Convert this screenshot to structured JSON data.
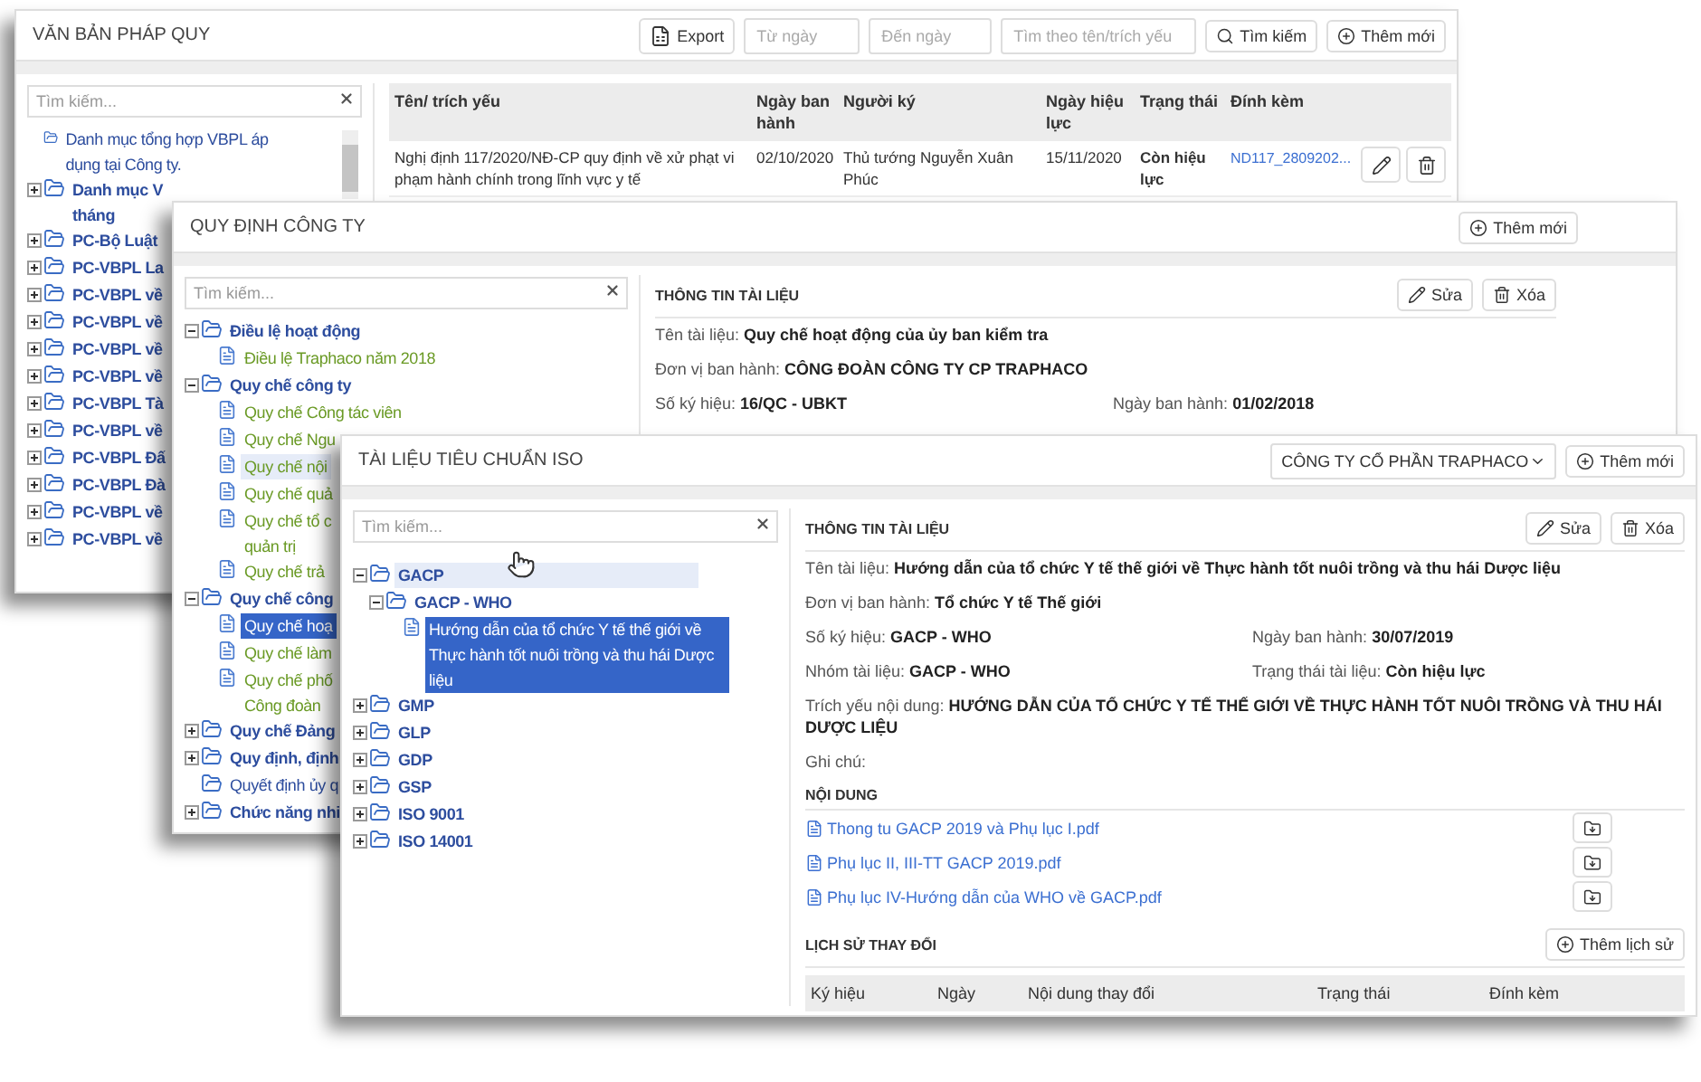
{
  "legal_docs_window": {
    "title": "VĂN BẢN PHÁP QUY",
    "export_button": "Export",
    "from_date": {
      "placeholder": "Từ ngày"
    },
    "to_date": {
      "placeholder": "Đến ngày"
    },
    "search_field": {
      "placeholder": "Tìm theo tên/trích yếu"
    },
    "search_button": "Tìm kiếm",
    "add_button": "Thêm mới",
    "tree_search": {
      "placeholder": "Tìm kiếm..."
    },
    "tree": [
      {
        "kind": "empty-folder",
        "label": "Danh mục tổng hợp VBPL áp dụng tại Công ty.",
        "selected": false,
        "hovered": false
      },
      {
        "kind": "folder",
        "label": "Danh mục V\ntháng",
        "expanded": false,
        "selected": false,
        "hovered": false
      },
      {
        "kind": "folder",
        "label": "PC-Bộ Luật",
        "expanded": false,
        "selected": false,
        "hovered": false
      },
      {
        "kind": "folder",
        "label": "PC-VBPL La",
        "expanded": false,
        "selected": false,
        "hovered": false
      },
      {
        "kind": "folder",
        "label": "PC-VBPL về",
        "expanded": false,
        "selected": false,
        "hovered": false
      },
      {
        "kind": "folder",
        "label": "PC-VBPL về",
        "expanded": false,
        "selected": false,
        "hovered": false
      },
      {
        "kind": "folder",
        "label": "PC-VBPL về",
        "expanded": false,
        "selected": false,
        "hovered": false
      },
      {
        "kind": "folder",
        "label": "PC-VBPL về",
        "expanded": false,
        "selected": false,
        "hovered": false
      },
      {
        "kind": "folder",
        "label": "PC-VBPL Tà",
        "expanded": false,
        "selected": false,
        "hovered": false
      },
      {
        "kind": "folder",
        "label": "PC-VBPL về",
        "expanded": false,
        "selected": false,
        "hovered": false
      },
      {
        "kind": "folder",
        "label": "PC-VBPL Đấ",
        "expanded": false,
        "selected": false,
        "hovered": false
      },
      {
        "kind": "folder",
        "label": "PC-VBPL Đà",
        "expanded": false,
        "selected": false,
        "hovered": false
      },
      {
        "kind": "folder",
        "label": "PC-VBPL về",
        "expanded": false,
        "selected": false,
        "hovered": false
      },
      {
        "kind": "folder",
        "label": "PC-VBPL về",
        "expanded": false,
        "selected": false,
        "hovered": false
      }
    ],
    "table": {
      "columns": [
        "Tên/ trích yếu",
        "Ngày ban hành",
        "Người ký",
        "Ngày hiệu lực",
        "Trạng thái",
        "Đính kèm"
      ],
      "rows": [
        {
          "title": "Nghị định 117/2020/NĐ-CP quy định về xử phạt vi phạm hành chính trong lĩnh vực y tế",
          "issued": "02/10/2020",
          "signer": "Thủ tướng Nguyễn Xuân Phúc",
          "effective": "15/11/2020",
          "status": "Còn hiệu lực",
          "attachment": "ND117_2809202..."
        }
      ]
    }
  },
  "company_rules_window": {
    "title": "QUY ĐỊNH CÔNG TY",
    "add_button": "Thêm mới",
    "tree_search": {
      "placeholder": "Tìm kiếm..."
    },
    "tree": [
      {
        "kind": "folder",
        "label": "Điều lệ hoạt động",
        "expanded": true,
        "selected": false,
        "hovered": false,
        "children": [
          {
            "kind": "document",
            "label": "Điều lệ Traphaco năm 2018",
            "selected": false,
            "hovered": false
          }
        ]
      },
      {
        "kind": "folder",
        "label": "Quy chế công ty",
        "expanded": true,
        "selected": false,
        "hovered": false,
        "children": [
          {
            "kind": "document",
            "label": "Quy chế Công tác viên",
            "selected": false,
            "hovered": false
          },
          {
            "kind": "document",
            "label": "Quy chế Ngu",
            "selected": false,
            "hovered": false
          },
          {
            "kind": "document",
            "label": "Quy chế nội",
            "selected": false,
            "hovered": true
          },
          {
            "kind": "document",
            "label": "Quy chế quả",
            "selected": false,
            "hovered": false
          },
          {
            "kind": "document",
            "label": "Quy chế tổ c\nquản trị",
            "selected": false,
            "hovered": false
          },
          {
            "kind": "document",
            "label": "Quy chế trả",
            "selected": false,
            "hovered": false
          }
        ]
      },
      {
        "kind": "folder",
        "label": "Quy chế công",
        "expanded": true,
        "selected": false,
        "hovered": false,
        "children": [
          {
            "kind": "document",
            "label": "Quy chế hoạ",
            "selected": true,
            "hovered": false
          },
          {
            "kind": "document",
            "label": "Quy chế làm",
            "selected": false,
            "hovered": false
          },
          {
            "kind": "document",
            "label": "Quy chế phố\nCông đoàn",
            "selected": false,
            "hovered": false
          }
        ]
      },
      {
        "kind": "folder",
        "label": "Quy chế Đảng",
        "expanded": false,
        "selected": false,
        "hovered": false
      },
      {
        "kind": "folder",
        "label": "Quy định, định",
        "expanded": false,
        "selected": false,
        "hovered": false
      },
      {
        "kind": "empty-folder",
        "label": "Quyết định ủy q",
        "selected": false,
        "hovered": false
      },
      {
        "kind": "folder",
        "label": "Chức năng nhi",
        "expanded": false,
        "selected": false,
        "hovered": false
      }
    ],
    "info": {
      "heading": "THÔNG TIN TÀI LIỆU",
      "edit_button": "Sửa",
      "delete_button": "Xóa",
      "fields": [
        {
          "kind": "full",
          "label": "Tên tài liệu:",
          "value": "Quy chế hoạt động của ủy ban kiểm tra"
        },
        {
          "kind": "full",
          "label": "Đơn vị ban hành:",
          "value": "CÔNG ĐOÀN CÔNG TY CP TRAPHACO"
        },
        {
          "kind": "half",
          "label": "Số ký hiệu:",
          "value": "16/QC - UBKT"
        },
        {
          "kind": "half",
          "label": "Ngày ban hành:",
          "value": "01/02/2018"
        }
      ]
    }
  },
  "iso_window": {
    "title": "TÀI LIỆU TIÊU CHUẨN ISO",
    "company_select": {
      "value": "CÔNG TY CỔ PHẦN TRAPHACO"
    },
    "add_button": "Thêm mới",
    "tree_search": {
      "placeholder": "Tìm kiếm..."
    },
    "tree": [
      {
        "kind": "folder",
        "label": "GACP",
        "expanded": true,
        "selected": false,
        "hovered": true,
        "children": [
          {
            "kind": "folder",
            "label": "GACP - WHO",
            "expanded": true,
            "selected": false,
            "hovered": false,
            "children": [
              {
                "kind": "document",
                "label": "Hướng dẫn của tổ chức Y tế thế giới về Thực hành tốt nuôi trồng và thu hái Dược liệu",
                "selected": true,
                "hovered": false
              }
            ]
          }
        ]
      },
      {
        "kind": "folder",
        "label": "GMP",
        "expanded": false,
        "selected": false,
        "hovered": false
      },
      {
        "kind": "folder",
        "label": "GLP",
        "expanded": false,
        "selected": false,
        "hovered": false
      },
      {
        "kind": "folder",
        "label": "GDP",
        "expanded": false,
        "selected": false,
        "hovered": false
      },
      {
        "kind": "folder",
        "label": "GSP",
        "expanded": false,
        "selected": false,
        "hovered": false
      },
      {
        "kind": "folder",
        "label": "ISO 9001",
        "expanded": false,
        "selected": false,
        "hovered": false
      },
      {
        "kind": "folder",
        "label": "ISO 14001",
        "expanded": false,
        "selected": false,
        "hovered": false
      }
    ],
    "info": {
      "heading": "THÔNG TIN TÀI LIỆU",
      "edit_button": "Sửa",
      "delete_button": "Xóa",
      "fields": [
        {
          "kind": "full",
          "label": "Tên tài liệu:",
          "value": "Hướng dẫn của tổ chức Y tế thế giới về Thực hành tốt nuôi trồng và thu hái Dược liệu"
        },
        {
          "kind": "full",
          "label": "Đơn vị ban hành:",
          "value": "Tổ chức Y tế Thế giới"
        },
        {
          "kind": "half",
          "label": "Số ký hiệu:",
          "value": "GACP - WHO"
        },
        {
          "kind": "half",
          "label": "Ngày ban hành:",
          "value": "30/07/2019"
        },
        {
          "kind": "half",
          "label": "Nhóm tài liệu:",
          "value": "GACP - WHO"
        },
        {
          "kind": "half",
          "label": "Trạng thái tài liệu:",
          "value": "Còn hiệu lực"
        },
        {
          "kind": "full",
          "label": "Trích yếu nội dung:",
          "value": "HƯỚNG DẪN CỦA TỔ CHỨC Y TẾ THẾ GIỚI  VỀ THỰC HÀNH TỐT NUÔI TRỒNG VÀ THU HÁI DƯỢC LIỆU"
        },
        {
          "kind": "full",
          "label": "Ghi chú:"
        }
      ]
    },
    "content": {
      "heading": "NỘI DUNG",
      "files": [
        "Thong tu GACP 2019 và Phụ lục I.pdf",
        "Phụ lục II, III-TT GACP 2019.pdf",
        "Phụ lục IV-Hướng dẫn của WHO về GACP.pdf"
      ]
    },
    "history": {
      "heading": "LỊCH SỬ THAY ĐỔI",
      "add_button": "Thêm lịch sử",
      "columns": [
        "Ký hiệu",
        "Ngày",
        "Nội dung thay đổi",
        "Trạng thái",
        "Đính kèm"
      ]
    }
  },
  "cursor": {
    "kind": "hand"
  }
}
